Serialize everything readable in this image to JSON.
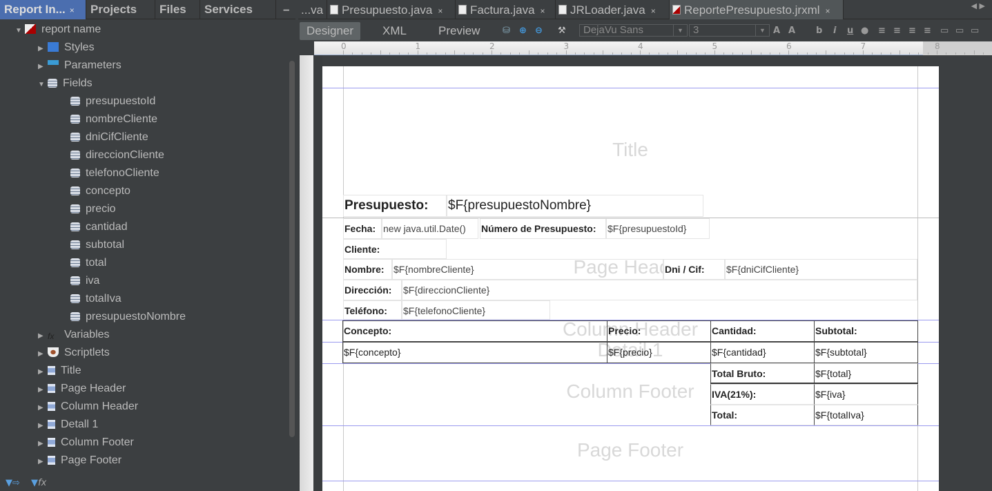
{
  "left_tabs": [
    {
      "label": "Report In...",
      "close": "×",
      "active": true
    },
    {
      "label": "Projects"
    },
    {
      "label": "Files"
    },
    {
      "label": "Services"
    }
  ],
  "minimize": "–",
  "tree": {
    "root": "report name",
    "items": [
      {
        "label": "Styles",
        "icon": "styles-icon"
      },
      {
        "label": "Parameters",
        "icon": "parameters-icon"
      },
      {
        "label": "Fields",
        "icon": "fields-icon",
        "expanded": true
      },
      {
        "label": "Variables",
        "icon": "fx-icon"
      },
      {
        "label": "Scriptlets",
        "icon": "scriptlet-cup-icon"
      },
      {
        "label": "Title",
        "icon": "band-icon"
      },
      {
        "label": "Page Header",
        "icon": "band-icon"
      },
      {
        "label": "Column Header",
        "icon": "band-icon"
      },
      {
        "label": "Detall 1",
        "icon": "band-icon"
      },
      {
        "label": "Column Footer",
        "icon": "band-icon"
      },
      {
        "label": "Page Footer",
        "icon": "band-icon"
      }
    ],
    "fields": [
      "presupuestoId",
      "nombreCliente",
      "dniCifCliente",
      "direccionCliente",
      "telefonoCliente",
      "concepto",
      "precio",
      "cantidad",
      "subtotal",
      "total",
      "iva",
      "totalIva",
      "presupuestoNombre"
    ]
  },
  "editor_tabs": [
    {
      "label": "...va"
    },
    {
      "label": "Presupuesto.java",
      "close": "×"
    },
    {
      "label": "Factura.java",
      "close": "×"
    },
    {
      "label": "JRLoader.java",
      "close": "×"
    },
    {
      "label": "ReportePresupuesto.jrxml",
      "close": "×",
      "active": true
    }
  ],
  "toolbar": {
    "views": [
      "Designer",
      "XML",
      "Preview"
    ],
    "active_view": "Designer",
    "font": "DejaVu Sans",
    "size": "3"
  },
  "ruler": [
    "0",
    "1",
    "2",
    "3",
    "4",
    "5",
    "6",
    "7",
    "8"
  ],
  "bands": [
    "Title",
    "Page Header",
    "Column Header",
    "Detail 1",
    "Column Footer",
    "Page Footer"
  ],
  "report": {
    "presupuesto_label": "Presupuesto:",
    "presupuesto_value": "$F{presupuestoNombre}",
    "fecha_label": "Fecha:",
    "fecha_value": "new java.util.Date()",
    "numero_label": "Número de Presupuesto:",
    "numero_value": "$F{presupuestoId}",
    "cliente_label": "Cliente:",
    "nombre_label": "Nombre:",
    "nombre_value": "$F{nombreCliente}",
    "dni_label": "Dni / Cif:",
    "dni_value": "$F{dniCifCliente}",
    "direccion_label": "Dirección:",
    "direccion_value": "$F{direccionCliente}",
    "telefono_label": "Teléfono:",
    "telefono_value": "$F{telefonoCliente}",
    "col_headers": [
      "Concepto:",
      "Precio:",
      "Cantidad:",
      "Subtotal:"
    ],
    "detail": [
      "$F{concepto}",
      "$F{precio}",
      "$F{cantidad}",
      "$F{subtotal}"
    ],
    "totals": [
      {
        "label": "Total Bruto:",
        "value": "$F{total}"
      },
      {
        "label": "IVA(21%):",
        "value": "$F{iva}"
      },
      {
        "label": "Total:",
        "value": "$F{totalIva}"
      }
    ]
  }
}
